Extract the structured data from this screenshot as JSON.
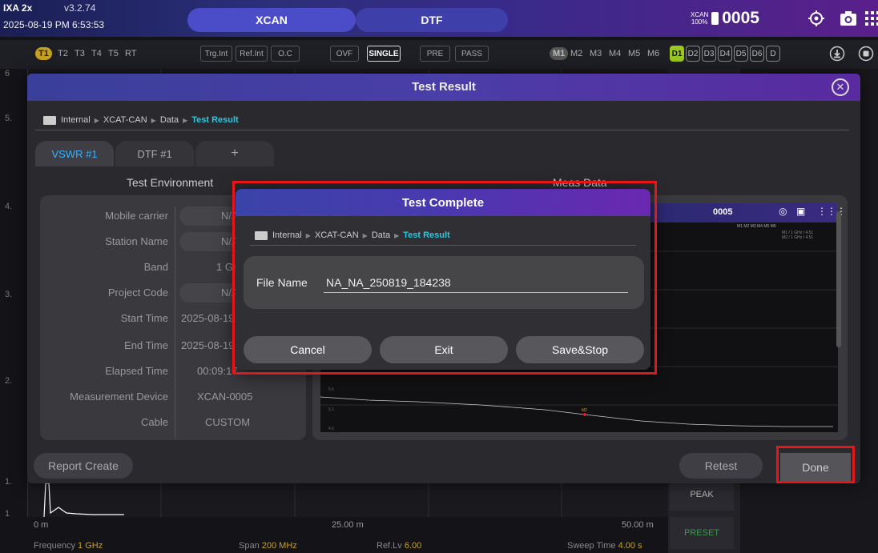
{
  "status_bar": {
    "device": "IXA 2x",
    "version": "v3.2.74",
    "datetime": "2025-08-19 PM 6:53:53",
    "mode_xcan": "XCAN",
    "mode_dtf": "DTF",
    "battery_label_top": "XCAN",
    "battery_label_bottom": "100%",
    "unit_number": "0005",
    "icons": [
      "target-icon",
      "camera-icon",
      "grid-menu-icon"
    ]
  },
  "traces": [
    "T1",
    "T2",
    "T3",
    "T4",
    "T5",
    "RT"
  ],
  "chips": [
    "Trg.Int",
    "Ref.Int",
    "O.C",
    "OVF",
    "SINGLE",
    "PRE",
    "PASS"
  ],
  "markers": [
    "M1",
    "M2",
    "M3",
    "M4",
    "M5",
    "M6"
  ],
  "displays": [
    "D1",
    "D2",
    "D3",
    "D4",
    "D5",
    "D6",
    "D"
  ],
  "bg_chart": {
    "y_ticks": [
      "6",
      "5.",
      "4.",
      "3.",
      "2.",
      "1.",
      "1"
    ],
    "x_ticks": [
      "0 m",
      "25.00 m",
      "50.00 m"
    ],
    "info": {
      "frequency_label": "Frequency",
      "frequency_value": "1 GHz",
      "span_label": "Span",
      "span_value": "200 MHz",
      "reflv_label": "Ref.Lv",
      "reflv_value": "6.00",
      "sweep_label": "Sweep Time",
      "sweep_value": "4.00 s"
    },
    "side_buttons": [
      "PEAK",
      "PRESET"
    ]
  },
  "test_result": {
    "title": "Test Result",
    "breadcrumb": [
      "Internal",
      "XCAT-CAN",
      "Data",
      "Test Result"
    ],
    "tabs": [
      "VSWR #1",
      "DTF #1",
      "+"
    ],
    "section_env": "Test Environment",
    "section_meas": "Meas Data",
    "env_rows": [
      {
        "label": "Mobile carrier",
        "value": "N/A"
      },
      {
        "label": "Station Name",
        "value": "N/A"
      },
      {
        "label": "Band",
        "value": "1 GH"
      },
      {
        "label": "Project Code",
        "value": "N/A"
      },
      {
        "label": "Start Time",
        "value": "2025-08-19"
      },
      {
        "label": "End Time",
        "value": "2025-08-19"
      },
      {
        "label": "Elapsed Time",
        "value": "00:09:17"
      },
      {
        "label": "Measurement Device",
        "value": "XCAN-0005"
      },
      {
        "label": "Cable",
        "value": "CUSTOM"
      }
    ],
    "mini": {
      "unit": "0005",
      "markers": "M1 M2 M3 M4 M5 M6",
      "m1_readout": "M1 / 1 GHz / 4.51",
      "m2_readout": "M2 / 1 GHz / 4.51",
      "y_ticks": [
        "5.6",
        "5.1",
        "4.6"
      ],
      "marker_tag": "M2"
    },
    "report_button": "Report Create",
    "retest_button": "Retest",
    "done_button": "Done"
  },
  "test_complete": {
    "title": "Test Complete",
    "breadcrumb": [
      "Internal",
      "XCAT-CAN",
      "Data",
      "Test Result"
    ],
    "file_name_label": "File Name",
    "file_name_value": "NA_NA_250819_184238",
    "cancel_button": "Cancel",
    "exit_button": "Exit",
    "save_button": "Save&Stop"
  },
  "colors": {
    "accent_cyan": "#2ac8e0",
    "highlight_red": "#e5151a",
    "trace_yellow": "#c8a020",
    "display_green": "#9ac820",
    "tab_blue": "#3ab0ff"
  }
}
